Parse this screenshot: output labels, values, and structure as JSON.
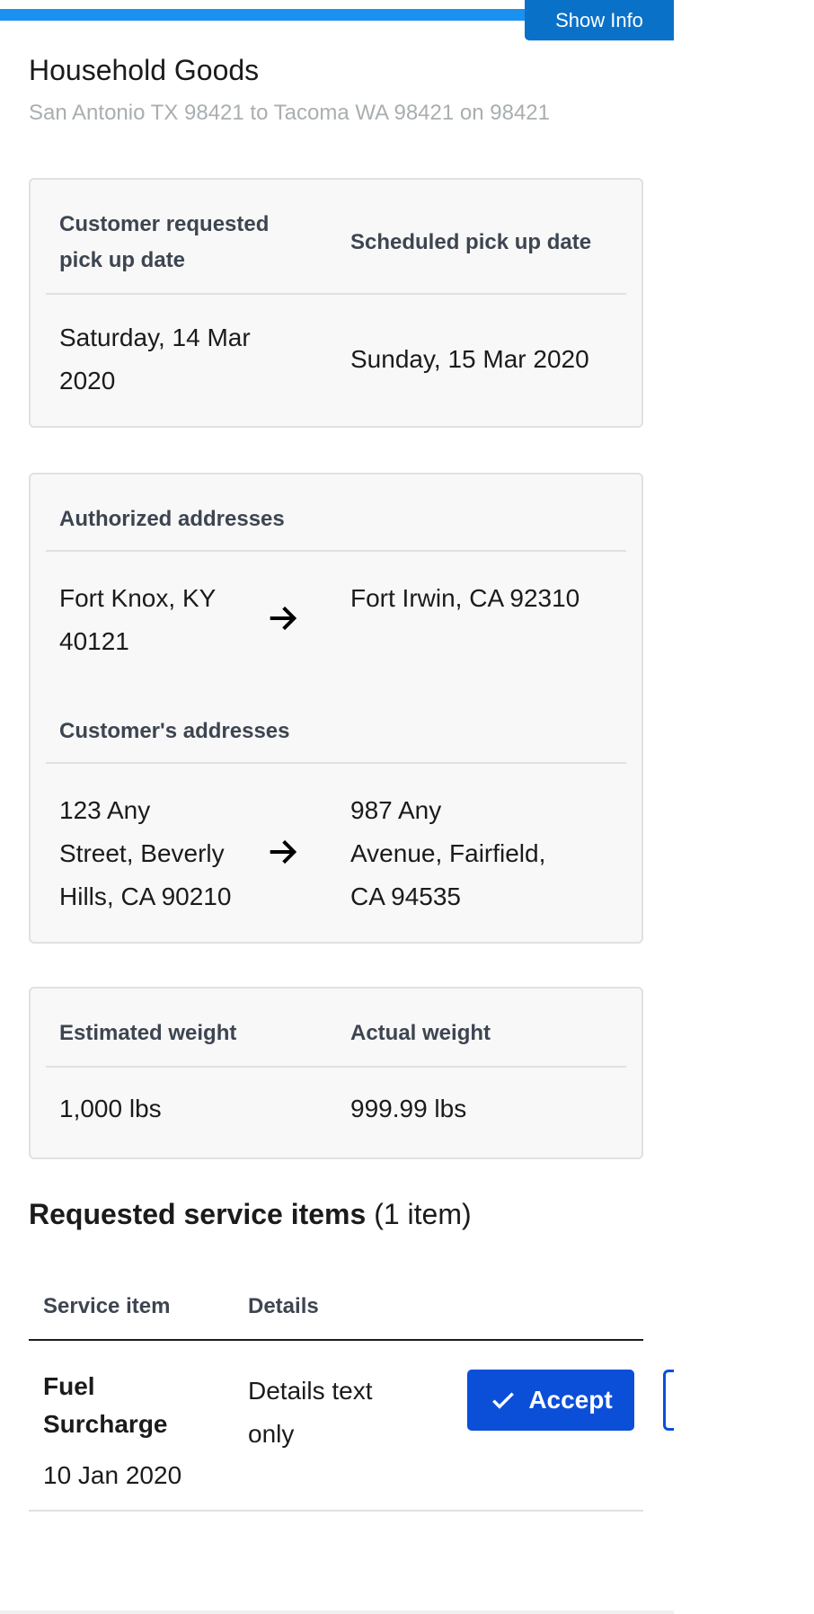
{
  "header": {
    "progress_percent": 78,
    "show_info_label": "Show Info",
    "title": "Household Goods",
    "subtitle": "San Antonio TX 98421 to Tacoma WA 98421 on 98421"
  },
  "dates": {
    "requested_header_line1": "Customer requested",
    "requested_header_line2": "pick up date",
    "scheduled_header": "Scheduled pick up date",
    "requested_value_line1": "Saturday, 14 Mar",
    "requested_value_line2": "2020",
    "scheduled_value": "Sunday, 15 Mar 2020"
  },
  "addresses": {
    "authorized_header": "Authorized addresses",
    "authorized_from_line1": "Fort Knox, KY",
    "authorized_from_line2": "40121",
    "authorized_to": "Fort Irwin, CA 92310",
    "customer_header": "Customer's addresses",
    "customer_from_line1": "123 Any",
    "customer_from_line2": "Street, Beverly",
    "customer_from_line3": "Hills, CA 90210",
    "customer_to_line1": "987 Any",
    "customer_to_line2": "Avenue, Fairfield,",
    "customer_to_line3": "CA 94535"
  },
  "weights": {
    "estimated_header": "Estimated weight",
    "actual_header": "Actual weight",
    "estimated_value": "1,000 lbs",
    "actual_value": "999.99 lbs"
  },
  "services": {
    "title": "Requested service items",
    "count": "(1 item)",
    "col_service": "Service item",
    "col_details": "Details",
    "items": [
      {
        "name_line1": "Fuel",
        "name_line2": "Surcharge",
        "date": "10 Jan 2020",
        "details_line1": "Details text",
        "details_line2": "only",
        "accept_label": "Accept"
      }
    ]
  },
  "icons": {
    "arrow": "arrow-right-icon",
    "check": "check-icon"
  },
  "colors": {
    "progress": "#1a91f0",
    "show_info_bg": "#0a71c9",
    "accept_bg": "#0b4fd8",
    "subtitle": "#a9aeb1",
    "card_bg": "#f8f8f8"
  }
}
